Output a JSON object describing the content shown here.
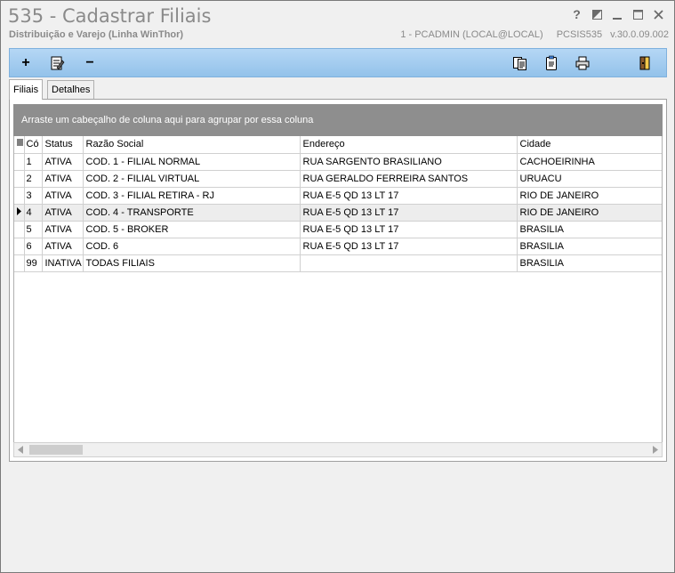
{
  "window": {
    "title": "535 - Cadastrar Filiais",
    "subtitle": "Distribuição e Varejo (Linha WinThor)",
    "user": "1 - PCADMIN (LOCAL@LOCAL)",
    "program": "PCSIS535",
    "version": "v.30.0.09.002"
  },
  "toolbar": {
    "add_label": "+",
    "remove_label": "−"
  },
  "tabs": [
    {
      "label": "Filiais",
      "active": true
    },
    {
      "label": "Detalhes",
      "active": false
    }
  ],
  "grid": {
    "group_hint": "Arraste um cabeçalho de coluna aqui para agrupar por essa coluna",
    "columns": [
      "Có",
      "Status",
      "Razão Social",
      "Endereço",
      "Cidade"
    ],
    "rows": [
      [
        "1",
        "ATIVA",
        "COD. 1 - FILIAL NORMAL",
        "RUA SARGENTO BRASILIANO",
        "CACHOEIRINHA"
      ],
      [
        "2",
        "ATIVA",
        "COD. 2 - FILIAL VIRTUAL",
        "RUA GERALDO FERREIRA SANTOS",
        "URUACU"
      ],
      [
        "3",
        "ATIVA",
        "COD. 3 - FILIAL RETIRA - RJ",
        "RUA E-5 QD 13 LT 17",
        "RIO DE JANEIRO"
      ],
      [
        "4",
        "ATIVA",
        "COD. 4 - TRANSPORTE",
        "RUA E-5 QD 13 LT 17",
        "RIO DE JANEIRO"
      ],
      [
        "5",
        "ATIVA",
        "COD. 5 - BROKER",
        "RUA E-5 QD 13 LT 17",
        "BRASILIA"
      ],
      [
        "6",
        "ATIVA",
        "COD. 6",
        "RUA E-5 QD 13 LT 17",
        "BRASILIA"
      ],
      [
        "99",
        "INATIVA",
        "TODAS FILIAIS",
        "",
        "BRASILIA"
      ]
    ],
    "current_row_index": 3
  }
}
